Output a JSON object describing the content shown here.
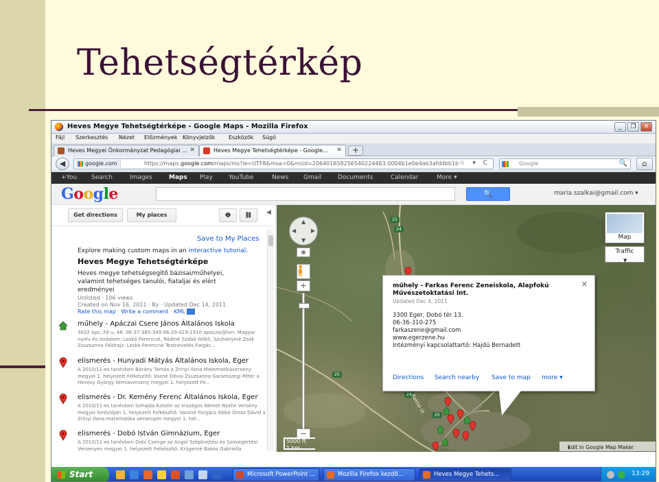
{
  "slide": {
    "title": "Tehetségtérkép"
  },
  "window": {
    "title": "Heves Megye Tehetségtérképe - Google Maps - Mozilla Firefox",
    "controls": [
      "_",
      "❐",
      "✕"
    ]
  },
  "menu": [
    "Fájl",
    "Szerkesztés",
    "Nézet",
    "Előzmények",
    "Könyvjelzők",
    "Eszközök",
    "Súgó"
  ],
  "tabs": [
    {
      "label": "Heves Megyei Önkormányzat Pedagógiai ...",
      "close": "✕"
    },
    {
      "label": "Heves Megye Tehetségtérképe - Google...",
      "close": "✕"
    }
  ],
  "new_tab_label": "+",
  "navbar": {
    "back": "◀",
    "site": "google.com",
    "url_prefix": "https://maps.",
    "url_domain": "google.com",
    "url_rest": "/maps/ms?ie=UTF8&msa=0&msid=206401658256540224463.0004b1e0e4ab3afddbb1b",
    "url_tools": "☆ ▾ C",
    "search_placeholder": "Google",
    "search_icon": "🔍",
    "home": "⌂"
  },
  "gbar": [
    "+You",
    "Search",
    "Images",
    "Maps",
    "Play",
    "YouTube",
    "News",
    "Gmail",
    "Documents",
    "Calendar",
    "More ▾"
  ],
  "gbar_active": "Maps",
  "header": {
    "logo": [
      "G",
      "o",
      "o",
      "g",
      "l",
      "e"
    ],
    "logo_colors": [
      "#3369e8",
      "#d50f25",
      "#eeb211",
      "#3369e8",
      "#009925",
      "#d50f25"
    ],
    "search_button": "🔍",
    "account": "maria.szalkai@gmail.com ▾"
  },
  "sidebar": {
    "get_directions": "Get directions",
    "my_places": "My places",
    "print_icon": "🖶",
    "link_icon": "⛓",
    "collapse": "◀",
    "save_to_places": "Save to My Places",
    "explore_prefix": "Explore making custom maps in an ",
    "explore_link": "interactive tutorial",
    "explore_suffix": ".",
    "map_title": "Heves Megye Tehetségtérképe",
    "map_desc": "Heves megye tehetségsegítő bázisai/műhelyei, valamint tehetséges tanulói, fiataljai és elért eredményei",
    "meta_line1": "Unlisted · 106 views",
    "meta_line2": "Created on Nov 16, 2011 · By  · Updated Dec 14, 2011",
    "rate": "Rate this map",
    "write_comment": "Write a comment",
    "kml": "KML",
    "sep": " · ",
    "places": [
      {
        "title": "műhely - Apáczai Csere János Általános Iskola",
        "body": "3032 Apc, Fő u. 48. 06-37-385-349 06-20-419-1910 apaczai@tvn. Magyar nyelv és irodalom: Leskó Ferencné, Rádiné Szabó Ildikó, Szuhányiné Zsák Zsuzsanna Földrajz: Leskó Ferencné Testnevelés Forgác...",
        "icon": "house"
      },
      {
        "title": "elismerés - Hunyadi Mátyás Általános Iskola, Eger",
        "body": "A 2010/11-es tanévben Bárány Tamás a Zrínyi Ilona Matematikaverseny megyei 1. helyezett Felkészítő: Vasné Dévai Zsuzsanna  Garamszegi Péter a Hevesy György kémiaverseny megyei 1. helyezett Fe...",
        "icon": "pin"
      },
      {
        "title": "elismerés - Dr. Kemény Ferenc Általános Iskola, Eger",
        "body": "A 2010/11-es tanévben Sohajda Katalin az országos Német Nyelvi Verseny megyei fordulóján 1. helyezett Felkészítő: Vassné Forgács Ildikó  Orosz Dávid a Zrínyi Ilona matematika versenyen megyei 1. hel...",
        "icon": "pin"
      },
      {
        "title": "elismerés - Dobó István Gimnázium, Eger",
        "body": "A 2010/11-es tanévben Dobi Csenge az Angol Szépkiejtési és Szövegértési Versenyen megyei 1. helyezett Felkészítő: Krügerné Bakos Gabriella Doktorcsik Noémi a Kazinczy szép magyar beszéd...",
        "icon": "pin"
      }
    ]
  },
  "map": {
    "pan_arrows": [
      "▲",
      "◀",
      "▶",
      "▼"
    ],
    "zoom_in": "+",
    "zoom_out": "−",
    "map_type": "Map",
    "traffic": "Traffic",
    "traffic_caret": "▼",
    "scale_ft": "5000 ft",
    "scale_km": "1 km",
    "footer": "Edit in Google Map Maker",
    "footer_caret": "▾",
    "route_labels": [
      "25",
      "24",
      "25",
      "25",
      "24",
      "25"
    ],
    "road_label": "Baktai út",
    "pin_color": "#e0342a",
    "house_color": "#3a9a3a",
    "info": {
      "close": "✕",
      "title": "műhely - Farkas Ferenc Zeneiskola, Alapfokú Művészetoktatási Int.",
      "updated": "Updated Dec 4, 2011",
      "lines": [
        "3300 Eger, Dobó tér 13.",
        "06-36-310-275",
        "farkaszene@gmail.com",
        "www.egerzene.hu",
        "Intézményi kapcsolattartó: Hajdú Bernadett"
      ],
      "actions": [
        "Directions",
        "Search nearby",
        "Save to map",
        "more ▾"
      ]
    }
  },
  "taskbar": {
    "start": "Start",
    "tasks": [
      "Microsoft PowerPoint ...",
      "Mozilla Firefox kezdő...",
      "Heves Megye Tehets..."
    ],
    "clock": "13:29"
  }
}
